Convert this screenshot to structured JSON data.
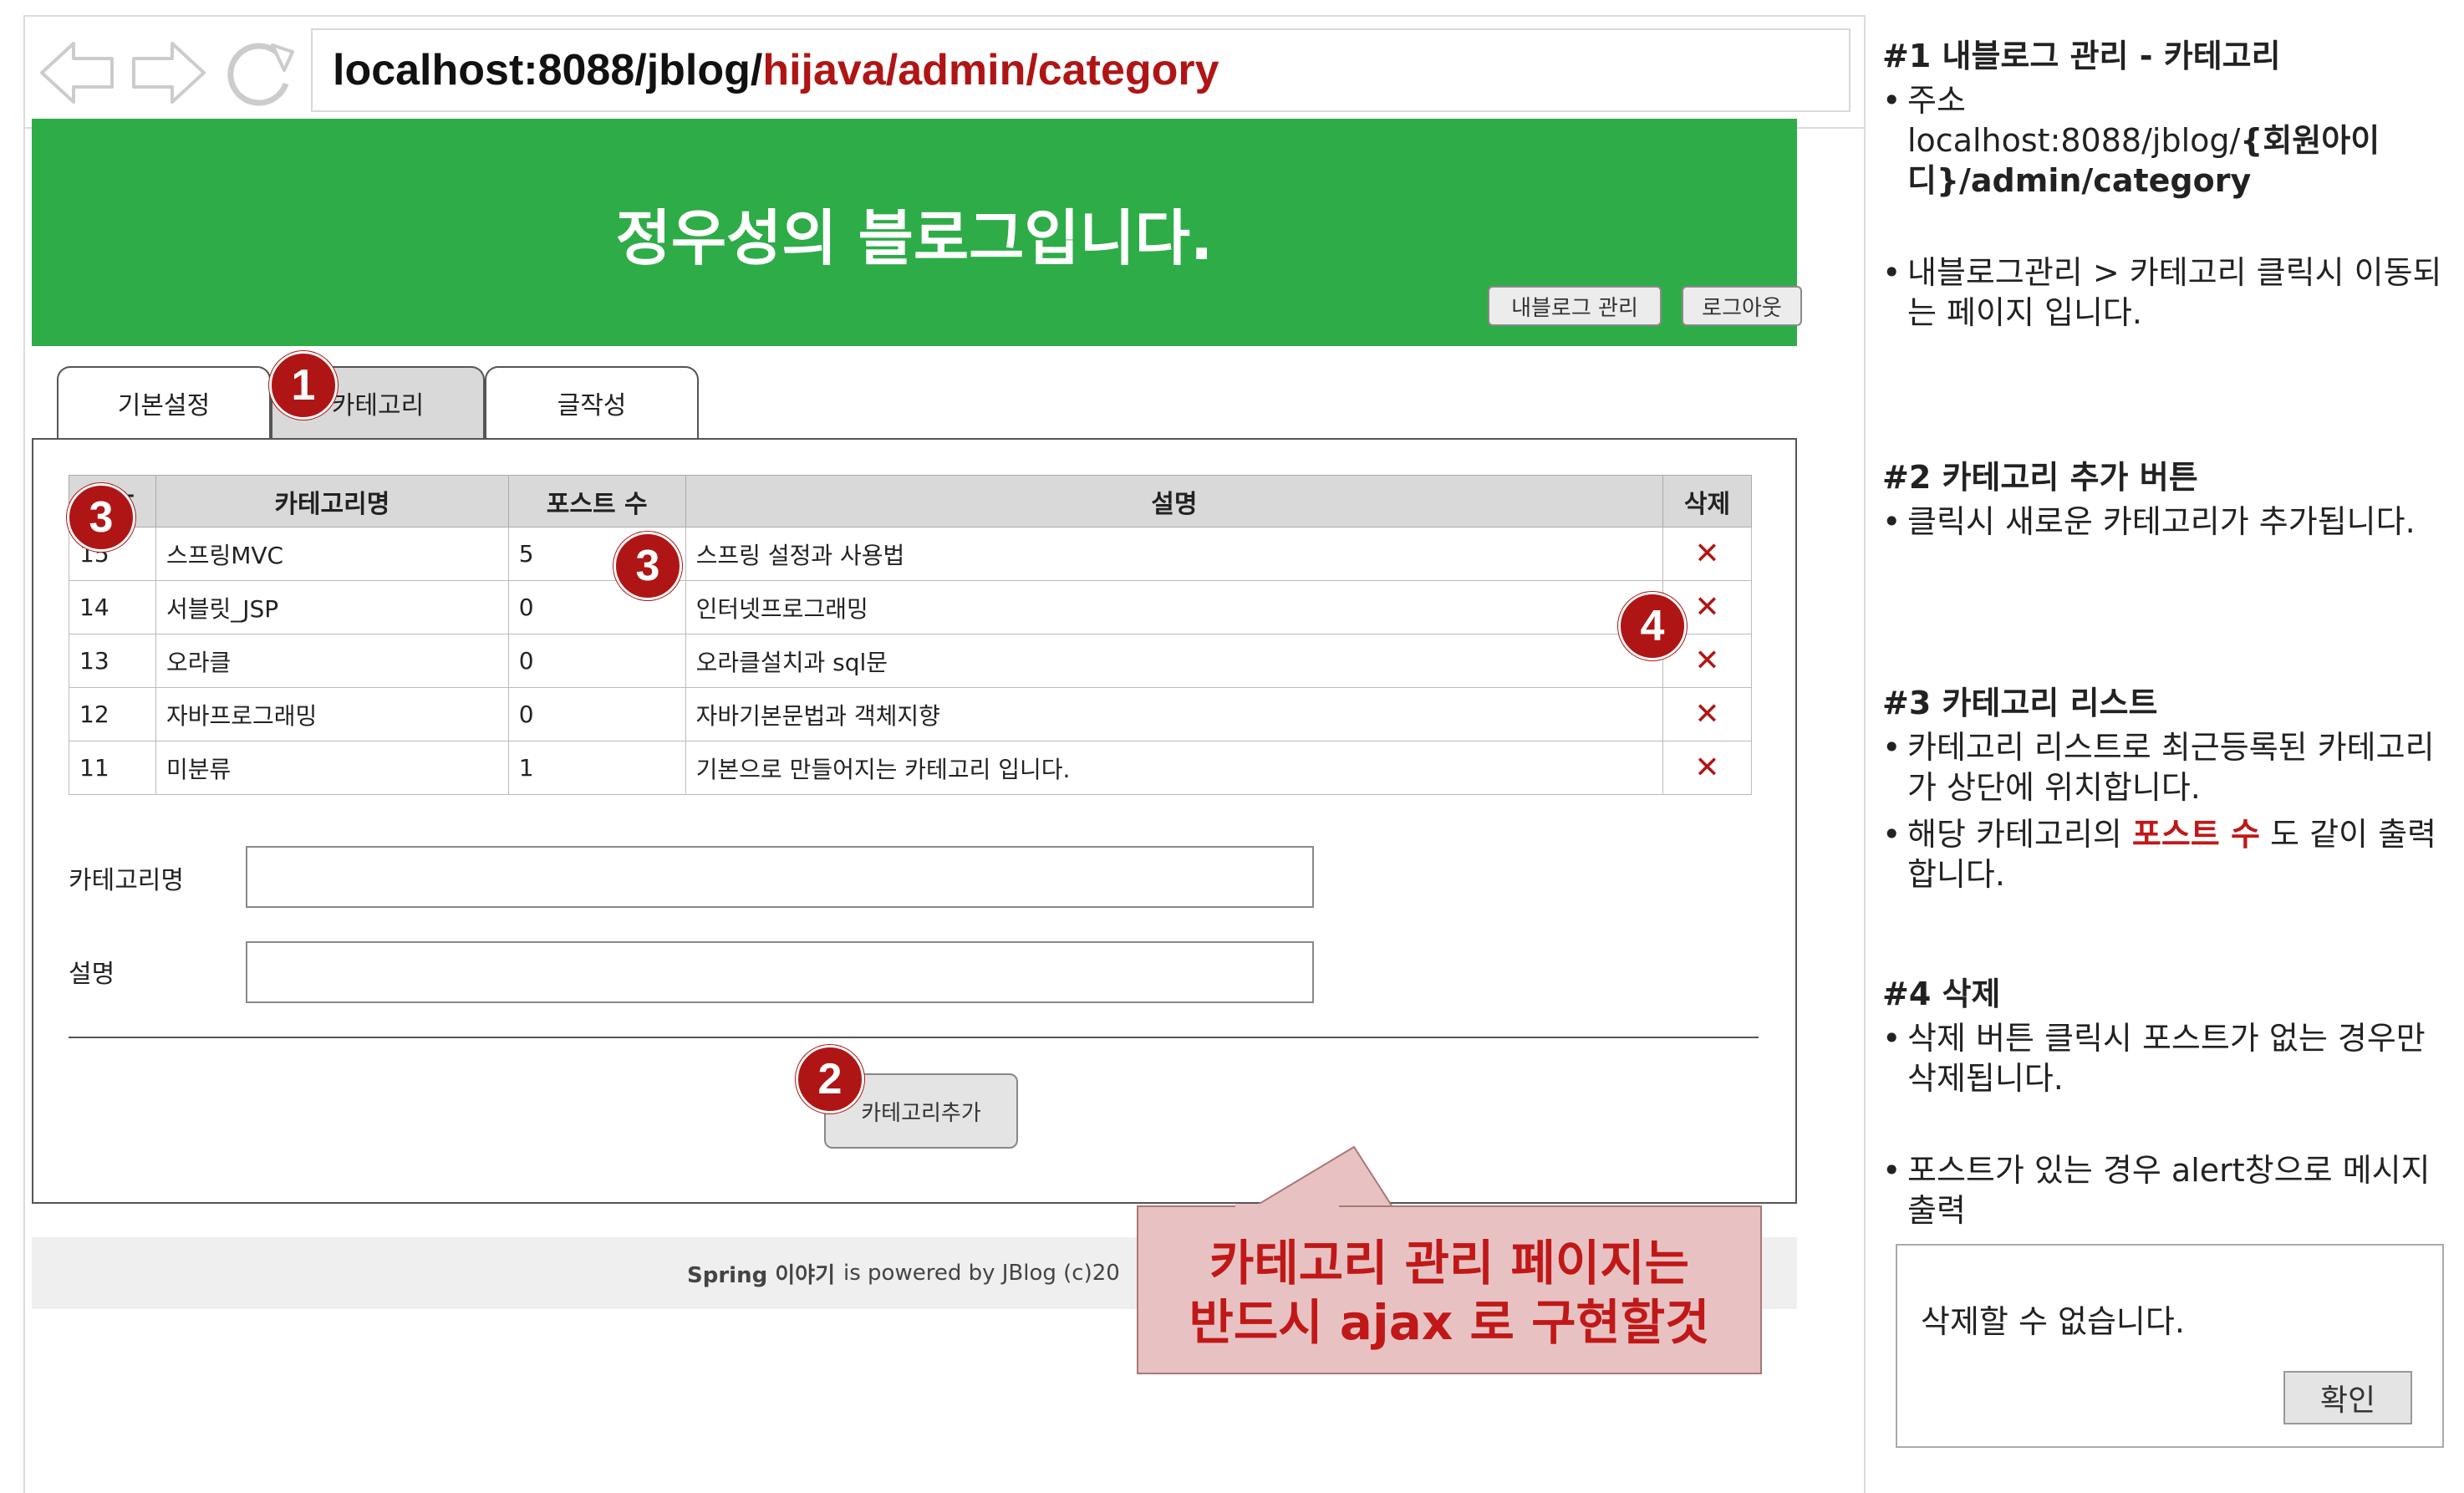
{
  "browser": {
    "url_base": "localhost:8088/jblog/",
    "url_path": "hijava/admin/category"
  },
  "header": {
    "title": "정우성의 블로그입니다.",
    "my_blog_label": "내블로그 관리",
    "logout_label": "로그아웃"
  },
  "tabs": [
    {
      "label": "기본설정"
    },
    {
      "label": "카테고리"
    },
    {
      "label": "글작성"
    }
  ],
  "table": {
    "headers": [
      "번호",
      "카테고리명",
      "포스트 수",
      "설명",
      "삭제"
    ],
    "rows": [
      {
        "no": "15",
        "name": "스프링MVC",
        "posts": "5",
        "desc": "스프링 설정과 사용법"
      },
      {
        "no": "14",
        "name": "서블릿_JSP",
        "posts": "0",
        "desc": "인터넷프로그래밍"
      },
      {
        "no": "13",
        "name": "오라클",
        "posts": "0",
        "desc": "오라클설치과 sql문"
      },
      {
        "no": "12",
        "name": "자바프로그래밍",
        "posts": "0",
        "desc": "자바기본문법과 객체지향"
      },
      {
        "no": "11",
        "name": "미분류",
        "posts": "1",
        "desc": "기본으로 만들어지는 카테고리 입니다."
      }
    ],
    "delete_glyph": "✕"
  },
  "form": {
    "name_label": "카테고리명",
    "desc_label": "설명",
    "add_label": "카테고리추가"
  },
  "footer": {
    "strong": "Spring 이야기",
    "text": "is powered by JBlog (c)20"
  },
  "callout": {
    "line1": "카테고리 관리 페이지는",
    "line2": "반드시 ajax 로 구현할것"
  },
  "badges": [
    "1",
    "2",
    "3",
    "3",
    "4"
  ],
  "panel": {
    "s1": {
      "title": "#1 내블로그 관리 - 카테고리",
      "addr_label": "주소",
      "addr_a": "localhost:8088/jblog/",
      "addr_b": "{회원아이디}/admin/category",
      "desc": "내블로그관리 > 카테고리 클릭시 이동되는 페이지 입니다."
    },
    "s2": {
      "title": "#2 카테고리 추가 버튼",
      "desc": "클릭시 새로운 카테고리가 추가됩니다."
    },
    "s3": {
      "title": "#3 카테고리 리스트",
      "desc1": "카테고리 리스트로 최근등록된 카테고리가 상단에 위치합니다.",
      "desc2_a": "해당 카테고리의 ",
      "desc2_b": "포스트 수",
      "desc2_c": " 도 같이 출력합니다."
    },
    "s4": {
      "title": "#4 삭제",
      "desc1": "삭제 버튼 클릭시 포스트가 없는 경우만 삭제됩니다.",
      "desc2": "포스트가 있는 경우 alert창으로 메시지 출력"
    }
  },
  "alert": {
    "message": "삭제할 수 없습니다.",
    "ok_label": "확인"
  },
  "colors": {
    "header_green": "#2eac48",
    "accent_red": "#b01515",
    "callout_bg": "#e8c2c2"
  }
}
